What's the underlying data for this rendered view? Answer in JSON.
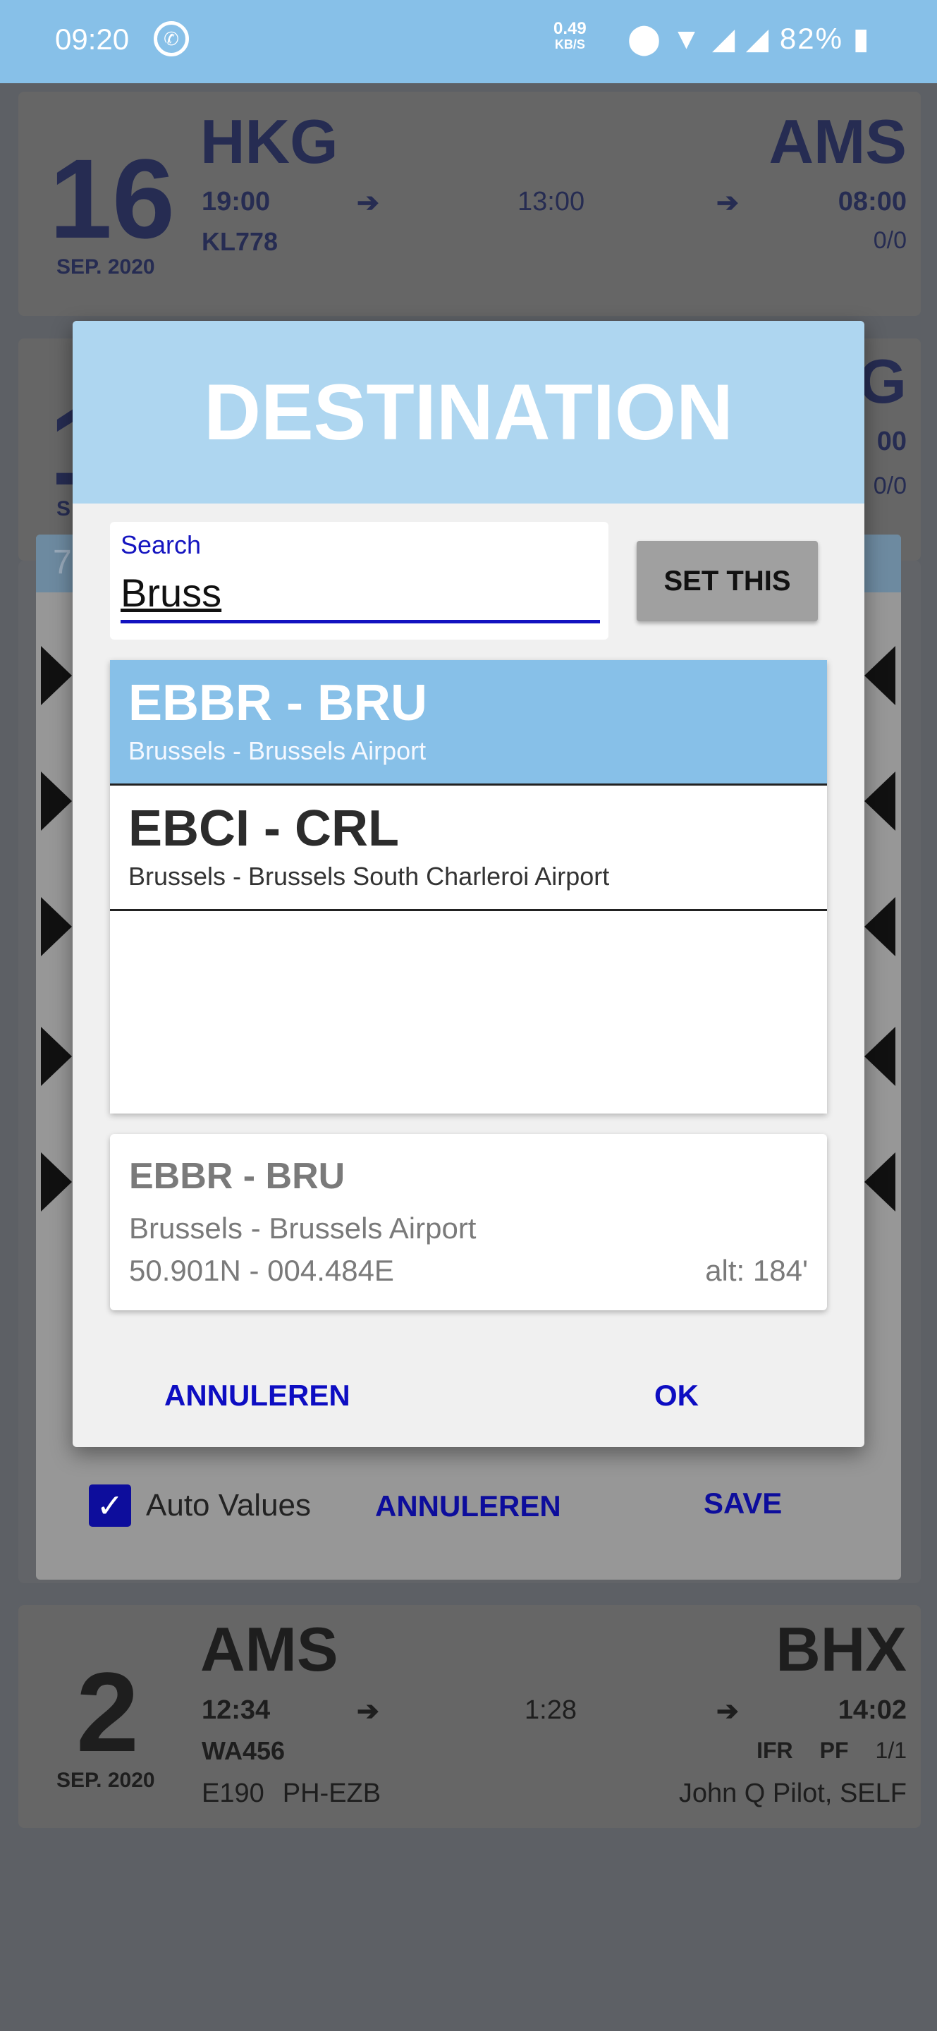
{
  "status_bar": {
    "time": "09:20",
    "app_icon": "whatsapp-icon",
    "net_speed": "0.49",
    "net_unit": "KB/S",
    "icons": [
      "location-icon",
      "wifi-icon",
      "signal-icon",
      "signal-icon"
    ],
    "battery": "82%"
  },
  "flights": [
    {
      "day": "16",
      "month": "SEP. 2020",
      "from": "HKG",
      "to": "AMS",
      "dep": "19:00",
      "duration": "13:00",
      "arr": "08:00",
      "flight": "KL778",
      "counts": "0/0"
    },
    {
      "day": "1",
      "month": "S",
      "to_partial": "G",
      "arr_partial": "00",
      "counts_partial": "0/0"
    },
    {
      "day": "2",
      "month": "SEP. 2020",
      "from": "AMS",
      "to": "BHX",
      "dep": "12:34",
      "duration": "1:28",
      "arr": "14:02",
      "flight": "WA456",
      "rules": "IFR",
      "role": "PF",
      "counts": "1/1",
      "aircraft": "E190",
      "registration": "PH-EZB",
      "crew": "John Q Pilot, SELF"
    }
  ],
  "edit_panel": {
    "header_partial": "7",
    "auto_values_label": "Auto Values",
    "auto_values_checked": true,
    "cancel": "ANNULEREN",
    "save": "SAVE"
  },
  "dialog": {
    "title": "DESTINATION",
    "search_label": "Search",
    "search_value": "Bruss",
    "set_this": "SET THIS",
    "results": [
      {
        "code": "EBBR - BRU",
        "name": "Brussels  - Brussels Airport",
        "selected": true
      },
      {
        "code": "EBCI - CRL",
        "name": "Brussels  - Brussels South Charleroi Airport",
        "selected": false
      }
    ],
    "detail": {
      "code": "EBBR - BRU",
      "name": "Brussels - Brussels Airport",
      "coords": "50.901N - 004.484E",
      "alt": "alt: 184'"
    },
    "cancel": "ANNULEREN",
    "ok": "OK"
  },
  "colors": {
    "accent": "#87c0e8",
    "button_text": "#0d0dc2",
    "dialog_header": "#aed6f0"
  }
}
